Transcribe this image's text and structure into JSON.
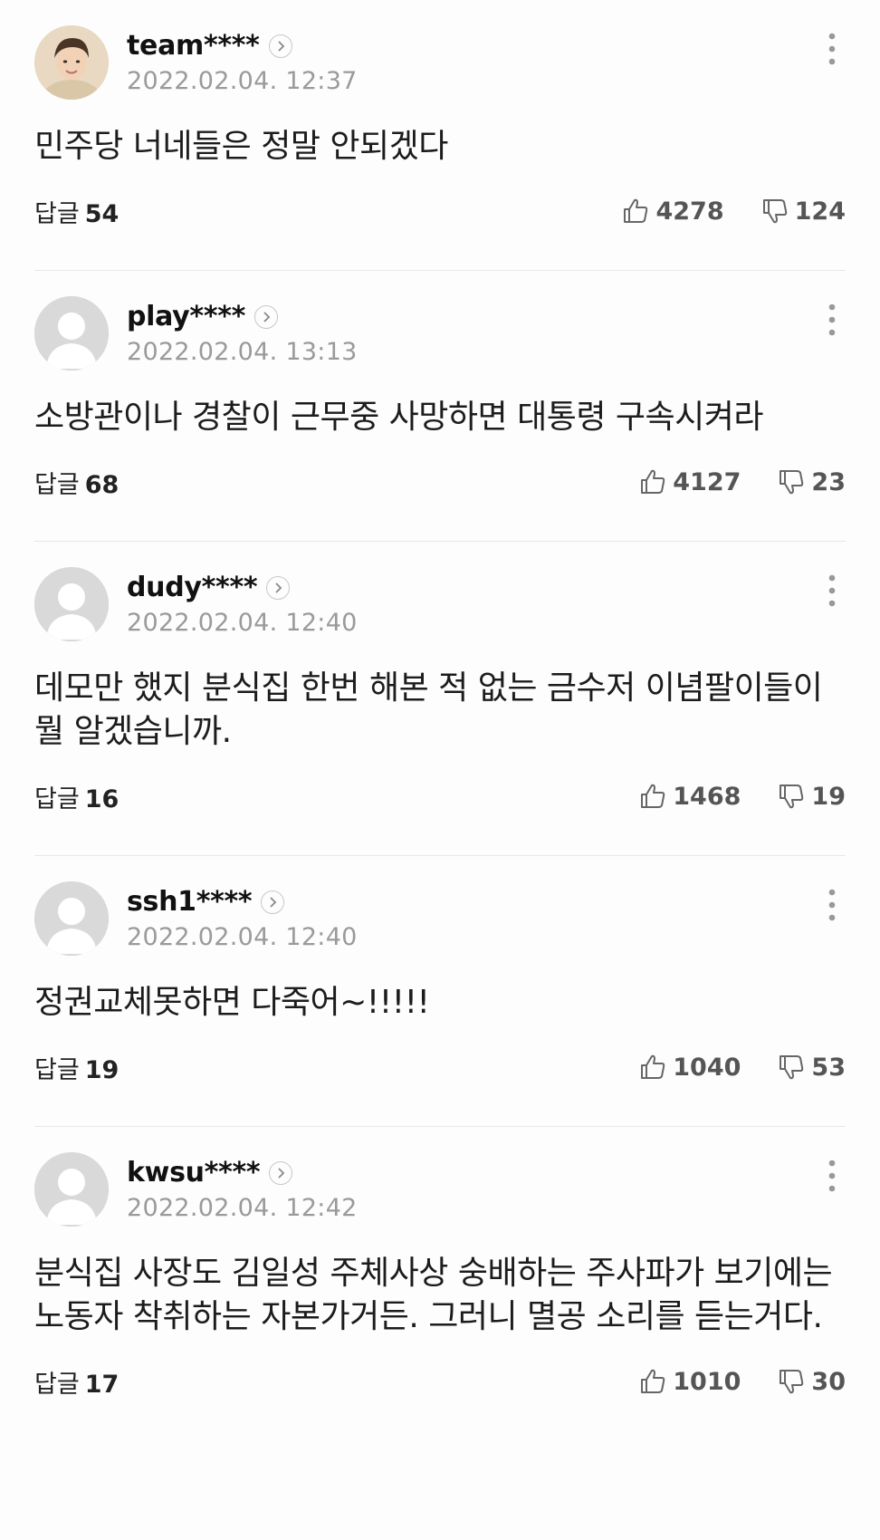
{
  "comments": [
    {
      "username": "team****",
      "date": "2022.02.04. 12:37",
      "text": "민주당 너네들은 정말 안되겠다",
      "reply_label": "답글",
      "reply_count": "54",
      "likes": "4278",
      "dislikes": "124",
      "has_photo_avatar": true
    },
    {
      "username": "play****",
      "date": "2022.02.04. 13:13",
      "text": "소방관이나 경찰이 근무중 사망하면 대통령 구속시켜라",
      "reply_label": "답글",
      "reply_count": "68",
      "likes": "4127",
      "dislikes": "23",
      "has_photo_avatar": false
    },
    {
      "username": "dudy****",
      "date": "2022.02.04. 12:40",
      "text": "데모만 했지 분식집 한번 해본 적 없는 금수저 이념팔이들이 뭘 알겠습니까.",
      "reply_label": "답글",
      "reply_count": "16",
      "likes": "1468",
      "dislikes": "19",
      "has_photo_avatar": false
    },
    {
      "username": "ssh1****",
      "date": "2022.02.04. 12:40",
      "text": "정권교체못하면 다죽어~!!!!!",
      "reply_label": "답글",
      "reply_count": "19",
      "likes": "1040",
      "dislikes": "53",
      "has_photo_avatar": false
    },
    {
      "username": "kwsu****",
      "date": "2022.02.04. 12:42",
      "text": "분식집 사장도 김일성 주체사상 숭배하는 주사파가 보기에는 노동자 착취하는 자본가거든. 그러니 멸공 소리를 듣는거다.",
      "reply_label": "답글",
      "reply_count": "17",
      "likes": "1010",
      "dislikes": "30",
      "has_photo_avatar": false
    }
  ],
  "icons": {
    "like": "thumbs-up-icon",
    "dislike": "thumbs-down-icon",
    "more": "more-vertical-icon",
    "profile": "chevron-right-icon",
    "avatar_default": "default-user-icon"
  },
  "colors": {
    "background": "#fdfdfd",
    "username": "#111111",
    "date": "#9a9a9a",
    "counts": "#555555",
    "divider": "#e8e8e8"
  }
}
